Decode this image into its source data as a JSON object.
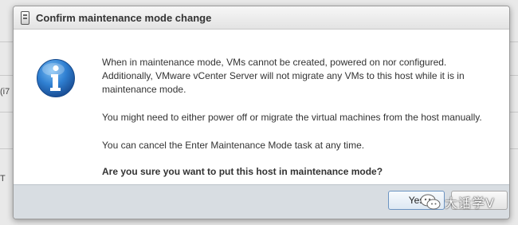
{
  "background": {
    "fragments": [
      "(i7",
      "T"
    ]
  },
  "dialog": {
    "title": "Confirm maintenance mode change",
    "icon": "info-icon",
    "paragraphs": [
      "When in maintenance mode, VMs cannot be created, powered on nor configured. Additionally, VMware vCenter Server will not migrate any VMs to this host while it is in maintenance mode.",
      "You might need to either power off or migrate the virtual machines from the host manually.",
      "You can cancel the Enter Maintenance Mode task at any time."
    ],
    "question": "Are you sure you want to put this host in maintenance mode?",
    "buttons": {
      "yes": "Yes",
      "no": ""
    }
  },
  "watermark": {
    "text": "大话学V"
  },
  "colors": {
    "info_icon": "#2f7fd1",
    "footer": "#d8dde2",
    "primary_border": "#6c94c2"
  }
}
